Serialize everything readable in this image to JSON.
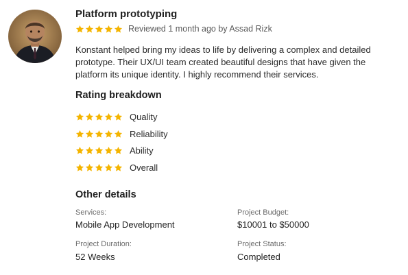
{
  "review": {
    "title": "Platform prototyping",
    "rating_stars": 5,
    "meta": "Reviewed 1 month ago by Assad Rizk",
    "text": "Konstant helped bring my ideas to life by delivering a complex and detailed prototype. Their UX/UI team created beautiful designs that have given the platform its unique identity. I highly recommend their services."
  },
  "breakdown": {
    "heading": "Rating breakdown",
    "items": [
      {
        "label": "Quality",
        "stars": 5
      },
      {
        "label": "Reliability",
        "stars": 5
      },
      {
        "label": "Ability",
        "stars": 5
      },
      {
        "label": "Overall",
        "stars": 5
      }
    ]
  },
  "details": {
    "heading": "Other details",
    "services_label": "Services:",
    "services_value": "Mobile App Development",
    "budget_label": "Project Budget:",
    "budget_value": "$10001 to $50000",
    "duration_label": "Project Duration:",
    "duration_value": "52 Weeks",
    "status_label": "Project Status:",
    "status_value": "Completed"
  },
  "colors": {
    "star": "#f4b400",
    "title": "#1f1f1f",
    "muted": "#5a5a5a"
  },
  "icons": {
    "avatar": "reviewer-avatar",
    "star": "star-icon"
  }
}
